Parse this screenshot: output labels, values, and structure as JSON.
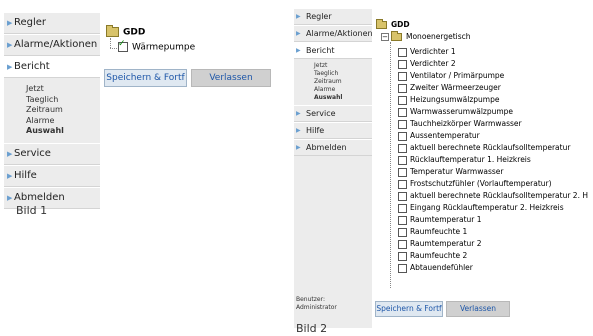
{
  "bild1": {
    "caption": "Bild 1",
    "nav": {
      "items": [
        {
          "label": "Regler"
        },
        {
          "label": "Alarme/Aktionen"
        },
        {
          "label": "Bericht"
        }
      ],
      "sub_items": [
        "Jetzt",
        "Taeglich",
        "Zeitraum",
        "Alarme",
        "Auswahl"
      ],
      "bottom_items": [
        {
          "label": "Service"
        },
        {
          "label": "Hilfe"
        },
        {
          "label": "Abmelden"
        }
      ]
    },
    "tree": {
      "root": "GDD",
      "leaf": {
        "label": "Wärmepumpe",
        "checked": true
      }
    },
    "buttons": {
      "save": "Speichern & Fortf",
      "leave": "Verlassen"
    }
  },
  "bild2": {
    "caption": "Bild 2",
    "nav": {
      "items": [
        {
          "label": "Regler"
        },
        {
          "label": "Alarme/Aktionen"
        },
        {
          "label": "Bericht"
        }
      ],
      "sub_items": [
        "Jetzt",
        "Taeglich",
        "Zeitraum",
        "Alarme",
        "Auswahl"
      ],
      "bottom_items": [
        {
          "label": "Service"
        },
        {
          "label": "Hilfe"
        },
        {
          "label": "Abmelden"
        }
      ],
      "user_label": "Benutzer:",
      "user_name": "Administrator"
    },
    "tree": {
      "root": "GDD",
      "group": "Monoenergetisch",
      "leaves": [
        "Verdichter 1",
        "Verdichter 2",
        "Ventilator / Primärpumpe",
        "Zweiter Wärmeerzeuger",
        "Heizungsumwälzpumpe",
        "Warmwasserumwälzpumpe",
        "Tauchheizkörper Warmwasser",
        "Aussentemperatur",
        "aktuell berechnete Rücklaufsolltemperatur",
        "Rücklauftemperatur 1. Heizkreis",
        "Temperatur Warmwasser",
        "Frostschutzfühler (Vorlauftemperatur)",
        "aktuell berechnete Rücklaufsolltemperatur 2. H",
        "Eingang Rücklauftemperatur 2. Heizkreis",
        "Raumtemperatur 1",
        "Raumfeuchte 1",
        "Raumtemperatur 2",
        "Raumfeuchte 2",
        "Abtauendefühler"
      ]
    },
    "buttons": {
      "save": "Speichern & Fortf",
      "leave": "Verlassen"
    }
  },
  "colors": {
    "nav_bg": "#ececec",
    "accent_arrow": "#6a9fd0",
    "button_text": "#1d56a8"
  }
}
